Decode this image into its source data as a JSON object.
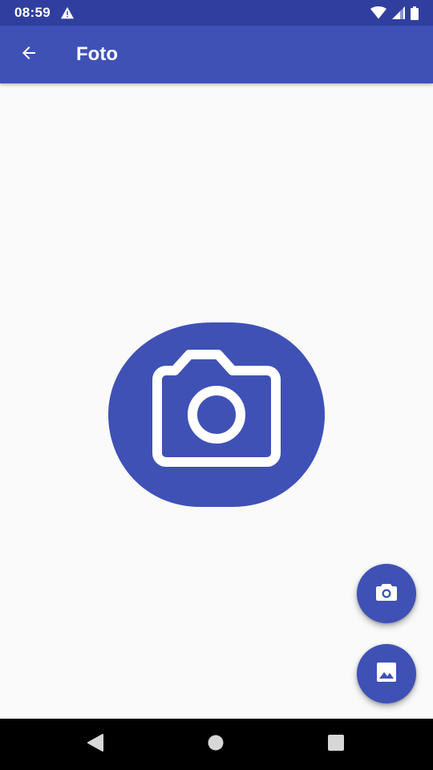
{
  "status_bar": {
    "time": "08:59",
    "icons": [
      "warning-icon",
      "wifi-icon",
      "signal-icon",
      "battery-icon"
    ]
  },
  "app_bar": {
    "title": "Foto",
    "back_icon": "arrow-back-icon",
    "color": "#3f51b5",
    "status_color": "#303f9f"
  },
  "content": {
    "placeholder_icon": "camera-icon"
  },
  "fabs": [
    {
      "name": "take-photo",
      "icon": "camera-icon"
    },
    {
      "name": "pick-from-gallery",
      "icon": "image-icon"
    }
  ],
  "nav_bar": {
    "icons": [
      "nav-back-icon",
      "nav-home-icon",
      "nav-recents-icon"
    ]
  }
}
